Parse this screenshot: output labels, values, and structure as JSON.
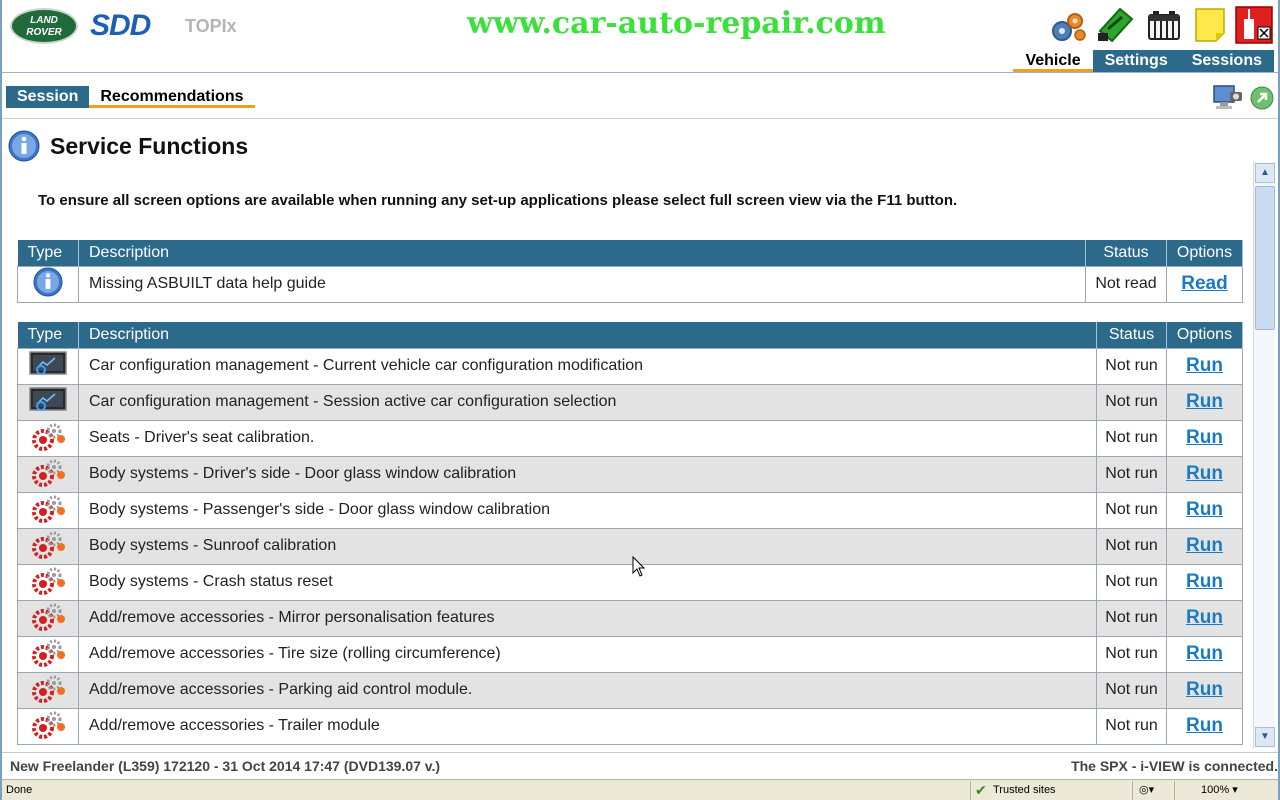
{
  "header": {
    "brand_logo_text": "LAND ROVER",
    "app_name": "SDD",
    "app_module": "TOPIx",
    "watermark": "www.car-auto-repair.com"
  },
  "main_tabs": [
    {
      "label": "Vehicle",
      "active": true
    },
    {
      "label": "Settings",
      "active": false
    },
    {
      "label": "Sessions",
      "active": false
    }
  ],
  "sub_tabs": [
    {
      "label": "Session",
      "active": true
    },
    {
      "label": "Recommendations",
      "active": false
    }
  ],
  "page": {
    "title": "Service Functions",
    "notice": "To ensure all screen options are available when running any set-up applications please select full screen view via the F11 button."
  },
  "help_table": {
    "headers": [
      "Type",
      "Description",
      "Status",
      "Options"
    ],
    "rows": [
      {
        "icon": "info-icon",
        "description": "Missing ASBUILT data help guide",
        "status": "Not read",
        "option": "Read"
      }
    ]
  },
  "functions_table": {
    "headers": [
      "Type",
      "Description",
      "Status",
      "Options"
    ],
    "rows": [
      {
        "icon": "config-monitor-icon",
        "description": "Car configuration management - Current vehicle car configuration modification",
        "status": "Not run",
        "option": "Run"
      },
      {
        "icon": "config-monitor-icon",
        "description": "Car configuration management - Session active car configuration selection",
        "status": "Not run",
        "option": "Run"
      },
      {
        "icon": "gears-icon",
        "description": "Seats - Driver's seat calibration.",
        "status": "Not run",
        "option": "Run"
      },
      {
        "icon": "gears-icon",
        "description": "Body systems - Driver's side - Door glass window calibration",
        "status": "Not run",
        "option": "Run"
      },
      {
        "icon": "gears-icon",
        "description": "Body systems - Passenger's side - Door glass window calibration",
        "status": "Not run",
        "option": "Run"
      },
      {
        "icon": "gears-icon",
        "description": "Body systems - Sunroof calibration",
        "status": "Not run",
        "option": "Run"
      },
      {
        "icon": "gears-icon",
        "description": "Body systems - Crash status reset",
        "status": "Not run",
        "option": "Run"
      },
      {
        "icon": "gears-icon",
        "description": "Add/remove accessories - Mirror personalisation features",
        "status": "Not run",
        "option": "Run"
      },
      {
        "icon": "gears-icon",
        "description": "Add/remove accessories - Tire size (rolling circumference)",
        "status": "Not run",
        "option": "Run"
      },
      {
        "icon": "gears-icon",
        "description": "Add/remove accessories - Parking aid control module.",
        "status": "Not run",
        "option": "Run"
      },
      {
        "icon": "gears-icon",
        "description": "Add/remove accessories - Trailer module",
        "status": "Not run",
        "option": "Run"
      }
    ]
  },
  "footer": {
    "vehicle_info": "New Freelander (L359) 172120 - 31 Oct 2014 17:47 (DVD139.07 v.)",
    "connection_status": "The SPX - i-VIEW is connected."
  },
  "browser_status": {
    "done": "Done",
    "zone": "Trusted sites",
    "zoom": "100%"
  },
  "colors": {
    "accent_blue": "#2c6a8c",
    "link_blue": "#1a7bc4",
    "tab_underline": "#f0a020",
    "watermark_green": "#3be03b"
  }
}
